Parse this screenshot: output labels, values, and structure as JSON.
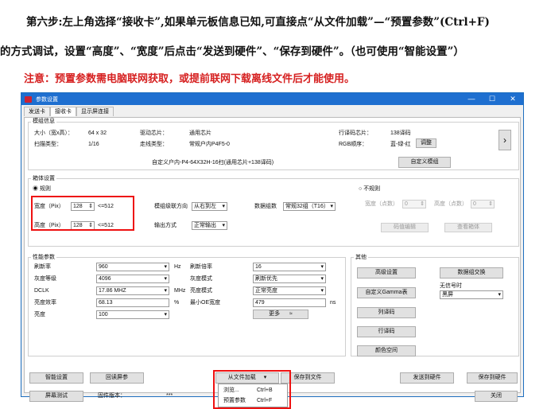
{
  "instructions": {
    "line1": "第六步:左上角选择“接收卡”,如果单元板信息已知,可直接点“从文件加载”—“预置参数”(Ctrl+F)",
    "line2": "的方式调试，设置“高度”、“宽度”后点击“发送到硬件”、“保存到硬件”。（也可使用“智能设置”）",
    "note": "注意：预置参数需电脑联网获取，或提前联网下载离线文件后才能使用。"
  },
  "window": {
    "title": "参数设置",
    "controls": [
      "—",
      "☐",
      "✕"
    ],
    "tabs": [
      "发送卡",
      "接收卡",
      "显示屏连接"
    ],
    "active_tab": "接收卡"
  },
  "module_info": {
    "title": "模组信息",
    "size_label": "大小（宽x高）：",
    "size_value": "64 x 32",
    "scan_label": "扫描类型：",
    "scan_value": "1/16",
    "driver_chip_label": "驱动芯片：",
    "driver_chip_value": "通用芯片",
    "decode_label": "走线类型：",
    "decode_value": "常规户内P4F5-0",
    "row_chip_label": "行译码芯片：",
    "row_chip_value": "138译码",
    "rgb_label": "RGB顺序：",
    "rgb_value": "蓝-绿-红",
    "adjust_btn": "调整",
    "summary": "自定义户内-P4-64X32H-16扫(通用芯片+138译码)",
    "custom_module_btn": "自定义模组"
  },
  "cabinet": {
    "title": "箱体设置",
    "regular": "规则",
    "irregular": "不规则",
    "width_label": "宽度（Pix）",
    "width_value": "128",
    "width_max": "<=512",
    "height_label": "高度（Pix）",
    "height_value": "128",
    "height_max": "<=512",
    "cascade_label": "模组级联方向",
    "cascade_value": "从右到左",
    "group_label": "数据组数",
    "group_value": "常规32组（T16）",
    "output_label": "输出方式",
    "output_value": "正常输出",
    "irr_width_label": "宽度（点数）",
    "irr_width_value": "0",
    "irr_height_label": "高度（点数）",
    "irr_height_value": "0",
    "irr_btn1": "码值编辑",
    "irr_btn2": "查看箱体"
  },
  "performance": {
    "title": "性能参数",
    "rows": [
      {
        "label": "刷新率",
        "value": "960",
        "unit": "Hz",
        "label2": "刷新倍率",
        "value2": "16"
      },
      {
        "label": "灰度等级",
        "value": "4096",
        "unit": "",
        "label2": "灰度模式",
        "value2": "刷新优先"
      },
      {
        "label": "DCLK",
        "value": "17.86 MHZ",
        "unit": "MHz",
        "label2": "亮度模式",
        "value2": "正常亮度"
      },
      {
        "label": "亮度效率",
        "value": "68.13",
        "unit": "%",
        "label2": "最小OE宽度",
        "value2": "479",
        "unit2": "ns"
      },
      {
        "label": "亮度",
        "value": "100",
        "unit": "",
        "label2": "",
        "value2": ""
      }
    ],
    "more_btn": "更多"
  },
  "other": {
    "title": "其他",
    "advanced_btn": "高级设置",
    "data_swap_btn": "数据组交换",
    "gamma_btn": "自定义Gamma表",
    "no_signal_label": "无信号时",
    "no_signal_value": "黑屏",
    "column_decode_btn": "列译码",
    "row_decode_btn": "行译码",
    "color_space_btn": "颜色空间"
  },
  "bottom": {
    "smart_btn": "智能设置",
    "read_back_btn": "回读屏参",
    "load_file_btn": "从文件加载",
    "save_file_btn": "保存到文件",
    "send_hw_btn": "发送到硬件",
    "save_hw_btn": "保存到硬件",
    "screen_test_btn": "屏幕测试",
    "firmware_label": "固件版本：",
    "firmware_value": "***",
    "close_btn": "关闭"
  },
  "load_menu": {
    "items": [
      {
        "label": "浏览...",
        "shortcut": "Ctrl+B"
      },
      {
        "label": "预置参数",
        "shortcut": "Ctrl+F"
      }
    ]
  },
  "colors": {
    "highlight": "#e11111",
    "note_text": "#d62020",
    "titlebar": "#1e6fd0"
  }
}
